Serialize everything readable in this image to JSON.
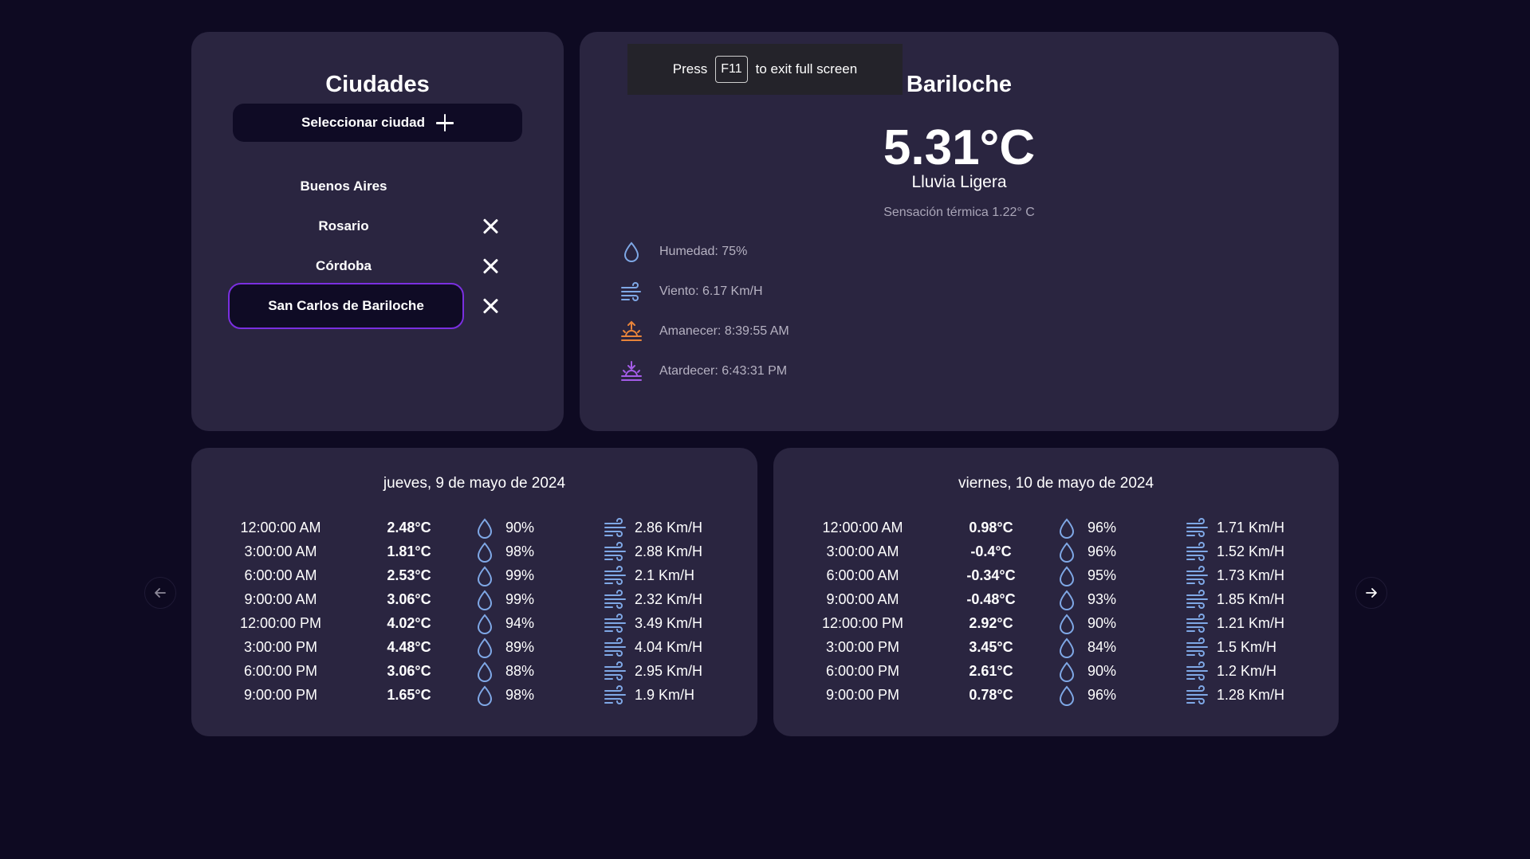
{
  "colors": {
    "background": "#0e0a22",
    "card": "#2a2540",
    "accent_border": "#7a2fe0",
    "water_icon": "#7fa8e6",
    "sunrise_icon": "#e8843a",
    "sunset_icon": "#a45ce8"
  },
  "cities": {
    "title": "Ciudades",
    "select_label": "Seleccionar ciudad",
    "list": [
      {
        "name": "Buenos Aires",
        "removable": false,
        "selected": false
      },
      {
        "name": "Rosario",
        "removable": true,
        "selected": false
      },
      {
        "name": "Córdoba",
        "removable": true,
        "selected": false
      },
      {
        "name": "San Carlos de Bariloche",
        "removable": true,
        "selected": true
      }
    ]
  },
  "fullscreen_banner": {
    "press": "Press",
    "key": "F11",
    "rest": "to exit full screen"
  },
  "current": {
    "city": "Bariloche",
    "temperature": "5.31°C",
    "description": "Lluvia Ligera",
    "feels_like": "Sensación térmica 1.22° C",
    "humidity": "Humedad: 75%",
    "wind": "Viento: 6.17 Km/H",
    "sunrise": "Amanecer: 8:39:55 AM",
    "sunset": "Atardecer: 6:43:31 PM"
  },
  "forecast": [
    {
      "date": "jueves, 9 de mayo de 2024",
      "rows": [
        {
          "time": "12:00:00 AM",
          "temp": "2.48°C",
          "humidity": "90%",
          "wind": "2.86 Km/H"
        },
        {
          "time": "3:00:00 AM",
          "temp": "1.81°C",
          "humidity": "98%",
          "wind": "2.88 Km/H"
        },
        {
          "time": "6:00:00 AM",
          "temp": "2.53°C",
          "humidity": "99%",
          "wind": "2.1 Km/H"
        },
        {
          "time": "9:00:00 AM",
          "temp": "3.06°C",
          "humidity": "99%",
          "wind": "2.32 Km/H"
        },
        {
          "time": "12:00:00 PM",
          "temp": "4.02°C",
          "humidity": "94%",
          "wind": "3.49 Km/H"
        },
        {
          "time": "3:00:00 PM",
          "temp": "4.48°C",
          "humidity": "89%",
          "wind": "4.04 Km/H"
        },
        {
          "time": "6:00:00 PM",
          "temp": "3.06°C",
          "humidity": "88%",
          "wind": "2.95 Km/H"
        },
        {
          "time": "9:00:00 PM",
          "temp": "1.65°C",
          "humidity": "98%",
          "wind": "1.9 Km/H"
        }
      ]
    },
    {
      "date": "viernes, 10 de mayo de 2024",
      "rows": [
        {
          "time": "12:00:00 AM",
          "temp": "0.98°C",
          "humidity": "96%",
          "wind": "1.71 Km/H"
        },
        {
          "time": "3:00:00 AM",
          "temp": "-0.4°C",
          "humidity": "96%",
          "wind": "1.52 Km/H"
        },
        {
          "time": "6:00:00 AM",
          "temp": "-0.34°C",
          "humidity": "95%",
          "wind": "1.73 Km/H"
        },
        {
          "time": "9:00:00 AM",
          "temp": "-0.48°C",
          "humidity": "93%",
          "wind": "1.85 Km/H"
        },
        {
          "time": "12:00:00 PM",
          "temp": "2.92°C",
          "humidity": "90%",
          "wind": "1.21 Km/H"
        },
        {
          "time": "3:00:00 PM",
          "temp": "3.45°C",
          "humidity": "84%",
          "wind": "1.5 Km/H"
        },
        {
          "time": "6:00:00 PM",
          "temp": "2.61°C",
          "humidity": "90%",
          "wind": "1.2 Km/H"
        },
        {
          "time": "9:00:00 PM",
          "temp": "0.78°C",
          "humidity": "96%",
          "wind": "1.28 Km/H"
        }
      ]
    }
  ]
}
